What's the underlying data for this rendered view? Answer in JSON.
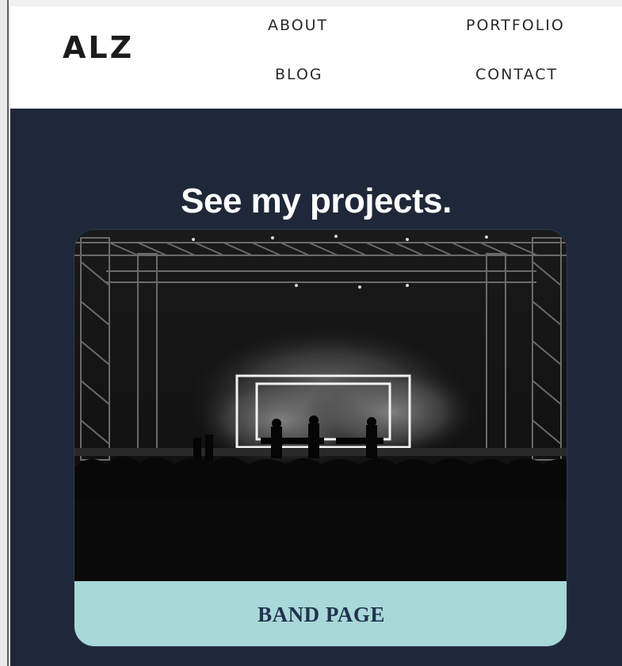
{
  "header": {
    "logo": "ALZ",
    "nav": {
      "about": "ABOUT",
      "portfolio": "PORTFOLIO",
      "blog": "BLOG",
      "contact": "CONTACT"
    }
  },
  "projects": {
    "heading": "See my projects.",
    "cards": [
      {
        "label": "BAND PAGE",
        "image": "concert-stage-photo"
      }
    ]
  },
  "colors": {
    "nav_bg": "#ffffff",
    "section_bg": "#1f2838",
    "card_footer_bg": "#a8d8d8",
    "card_label": "#22324f",
    "heading_text": "#ffffff"
  }
}
